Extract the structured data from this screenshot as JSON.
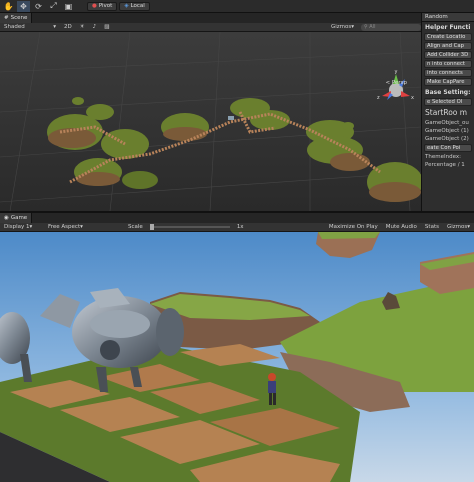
{
  "toolbar": {
    "tools": [
      {
        "name": "hand-icon",
        "glyph": "✋"
      },
      {
        "name": "move-icon",
        "glyph": "✥"
      },
      {
        "name": "rotate-icon",
        "glyph": "⟳"
      },
      {
        "name": "scale-icon",
        "glyph": "⤢"
      },
      {
        "name": "rect-icon",
        "glyph": "▣"
      }
    ],
    "pivot_label": "Pivot",
    "space_label": "Local"
  },
  "scene": {
    "tab_label": "Scene",
    "shading": "Shaded",
    "mode_2d": "2D",
    "gizmos": "Gizmos",
    "search_placeholder": "All",
    "persp_label": "< Persp",
    "axis_labels": {
      "y": "y",
      "x": "x",
      "z": "z"
    }
  },
  "side_panel": {
    "tab_label": "Random",
    "helper_title": "Helper Functi",
    "buttons": [
      "Create Locatio",
      "Align and Cap",
      "Add Collider 3D",
      "n into connect",
      "into connects",
      "Make CapPare"
    ],
    "base_title": "Base Setting:",
    "selected_button": "e Selected Ol",
    "start_room": "StartRoo m",
    "objects": [
      "GameObject_ou",
      "GameObject (1)",
      "GameObject (2)"
    ],
    "create_button": "eate Con Poi",
    "theme_label": "ThemeIndex:",
    "percentage_label": "Percentage / 1"
  },
  "game": {
    "tab_label": "Game",
    "display": "Display 1",
    "aspect": "Free Aspect",
    "scale_label": "Scale",
    "scale_value": "1x",
    "maximize": "Maximize On Play",
    "mute": "Mute Audio",
    "stats": "Stats",
    "gizmos": "Gizmos"
  },
  "colors": {
    "accent": "#3a4a5e",
    "sky_top": "#4d8ac8",
    "sky_bottom": "#a8c8e6",
    "grass": "#7a9a3a",
    "dirt": "#b58252"
  }
}
